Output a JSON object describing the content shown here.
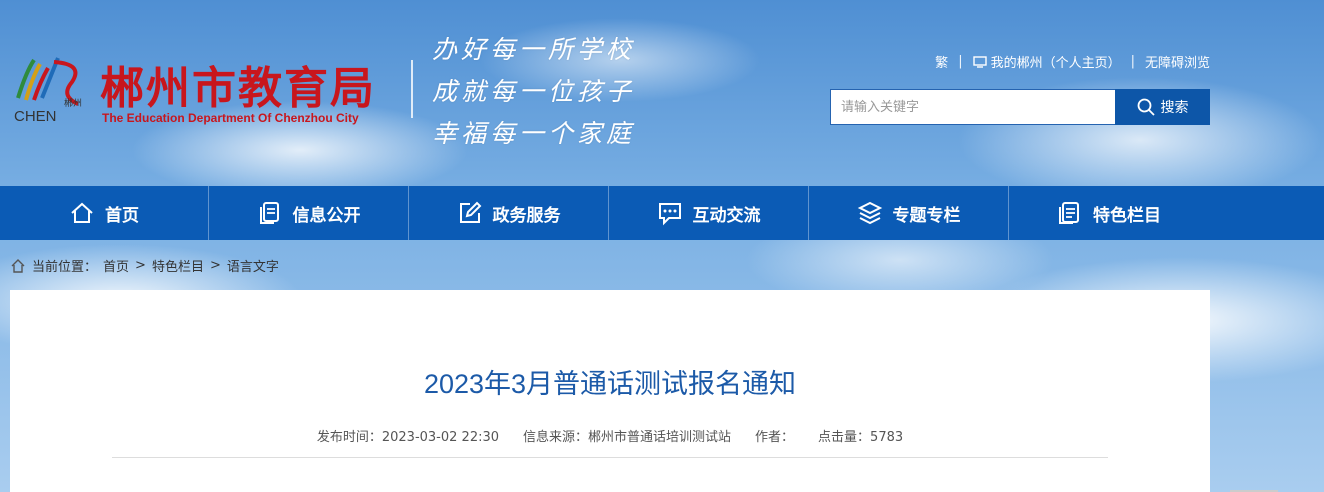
{
  "header": {
    "logo_cn": "郴州市教育局",
    "logo_en": "The Education Department Of Chenzhou City",
    "logo_mark_small": "郴州",
    "logo_mark_text": "CHEN",
    "slogans": [
      "办好每一所学校",
      "成就每一位孩子",
      "幸福每一个家庭"
    ]
  },
  "topbar": {
    "traditional": "繁",
    "my_chenzhou": "我的郴州（个人主页）",
    "accessible": "无障碍浏览"
  },
  "search": {
    "placeholder": "请输入关键字",
    "button_label": "搜索"
  },
  "nav": {
    "items": [
      {
        "label": "首页",
        "icon": "home-icon"
      },
      {
        "label": "信息公开",
        "icon": "document-icon"
      },
      {
        "label": "政务服务",
        "icon": "edit-icon"
      },
      {
        "label": "互动交流",
        "icon": "chat-icon"
      },
      {
        "label": "专题专栏",
        "icon": "layers-icon"
      },
      {
        "label": "特色栏目",
        "icon": "file-list-icon"
      }
    ]
  },
  "breadcrumb": {
    "prefix": "当前位置：",
    "items": [
      "首页",
      "特色栏目",
      "语言文字"
    ],
    "sep": ">"
  },
  "article": {
    "title": "2023年3月普通话测试报名通知",
    "publish_time": "发布时间：2023-03-02 22:30",
    "source": "信息来源：郴州市普通话培训测试站",
    "author": "作者：",
    "views": "点击量：5783"
  },
  "colors": {
    "brand_red": "#c8161d",
    "nav_blue": "#0b5bb5",
    "title_blue": "#1c5aa8"
  }
}
